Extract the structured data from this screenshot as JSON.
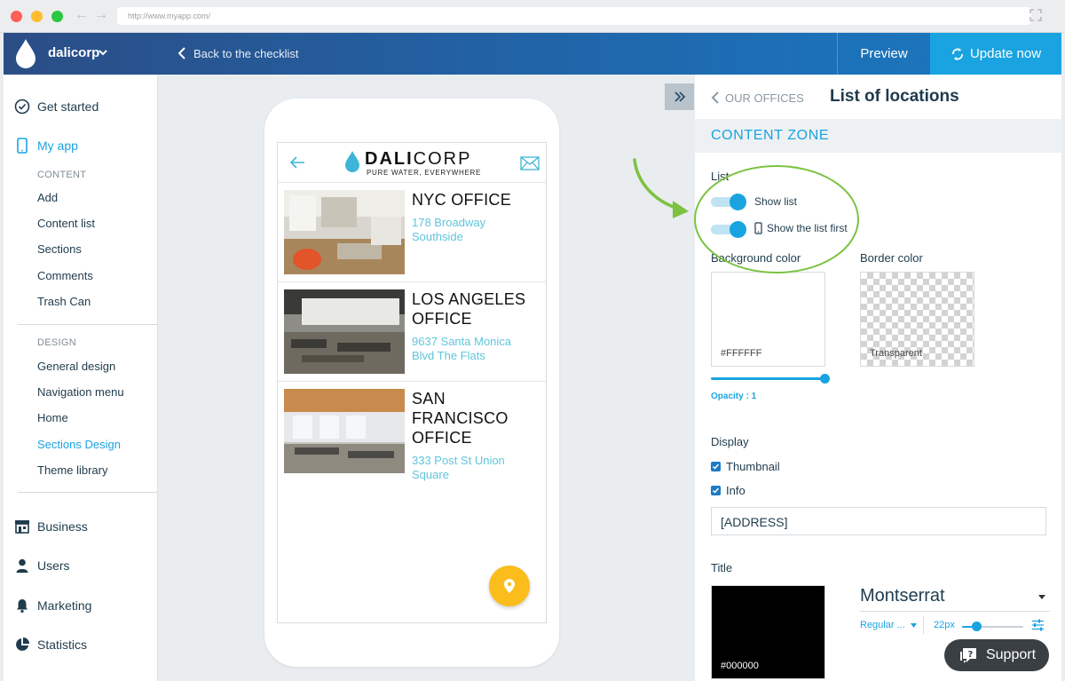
{
  "browser": {
    "url": "http://www.myapp.com/"
  },
  "header": {
    "brand": "dalicorp",
    "back_label": "Back to the checklist",
    "preview_label": "Preview",
    "update_label": "Update now"
  },
  "sidebar": {
    "get_started": "Get started",
    "my_app": "My app",
    "content_head": "CONTENT",
    "content_items": [
      "Add",
      "Content list",
      "Sections",
      "Comments",
      "Trash Can"
    ],
    "design_head": "DESIGN",
    "design_items": [
      "General design",
      "Navigation menu",
      "Home",
      "Sections Design",
      "Theme library"
    ],
    "active_design_item": "Sections Design",
    "business": "Business",
    "users": "Users",
    "marketing": "Marketing",
    "statistics": "Statistics"
  },
  "phone": {
    "logo_bold": "DALI",
    "logo_rest": "CORP",
    "tagline": "PURE WATER, EVERYWHERE",
    "offices": [
      {
        "name_lines": [
          "NYC OFFICE"
        ],
        "addr_lines": [
          "178 Broadway",
          "Southside"
        ]
      },
      {
        "name_lines": [
          "LOS ANGELES",
          "OFFICE"
        ],
        "addr_lines": [
          "9637 Santa Monica",
          "Blvd The Flats"
        ]
      },
      {
        "name_lines": [
          "SAN",
          "FRANCISCO",
          "OFFICE"
        ],
        "addr_lines": [
          "333 Post St Union",
          "Square"
        ]
      }
    ]
  },
  "panel": {
    "back_label": "OUR OFFICES",
    "title": "List of locations",
    "zone": "CONTENT ZONE",
    "list_label": "List",
    "show_list": "Show list",
    "show_list_first": "Show the list first",
    "bg_color_label": "Background color",
    "bg_color_value": "#FFFFFF",
    "border_color_label": "Border color",
    "border_color_value": "Transparent",
    "opacity_label": "Opacity : 1",
    "opacity": 1,
    "display_label": "Display",
    "thumbnail": "Thumbnail",
    "info": "Info",
    "info_field_value": "[ADDRESS]",
    "title_label": "Title",
    "title_color_value": "#000000",
    "font_name": "Montserrat",
    "font_weight": "Regular ...",
    "font_size": "22px"
  },
  "support_label": "Support",
  "colors": {
    "accent": "#1aa3e1",
    "header_dark": "#2b4d86",
    "fab": "#fbbd1c",
    "highlight": "#7dc242"
  }
}
